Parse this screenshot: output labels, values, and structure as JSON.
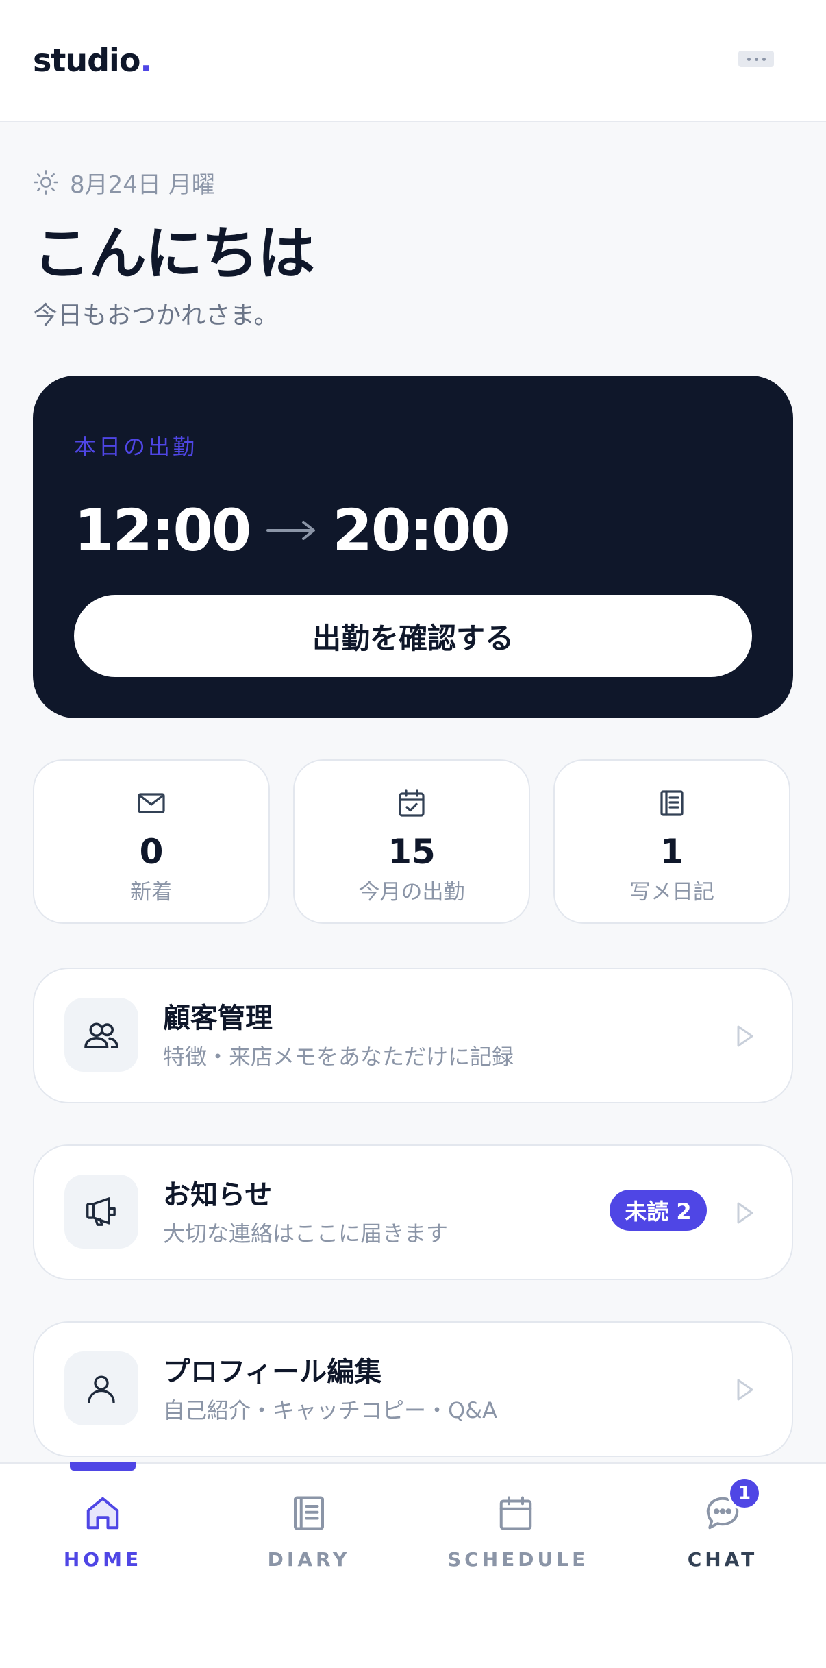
{
  "header": {
    "logo_text": "studio",
    "logo_dot": ".",
    "menu_icon": "more-dots-icon"
  },
  "greeting": {
    "date": "8月24日 月曜",
    "date_icon": "sun-icon",
    "title": "こんにちは",
    "subtitle": "今日もおつかれさま。"
  },
  "shift": {
    "label": "本日の出勤",
    "start": "12:00",
    "arrow": "→",
    "end": "20:00",
    "button_label": "出勤を確認する"
  },
  "stats": [
    {
      "icon": "mail-icon",
      "value": "0",
      "label": "新着"
    },
    {
      "icon": "calendar-check-icon",
      "value": "15",
      "label": "今月の出勤"
    },
    {
      "icon": "notebook-icon",
      "value": "1",
      "label": "写メ日記"
    }
  ],
  "menu": [
    {
      "icon": "users-icon",
      "title": "顧客管理",
      "desc": "特徴・来店メモをあなただけに記録",
      "badge": ""
    },
    {
      "icon": "megaphone-icon",
      "title": "お知らせ",
      "desc": "大切な連絡はここに届きます",
      "badge": "未読 2"
    },
    {
      "icon": "user-icon",
      "title": "プロフィール編集",
      "desc": "自己紹介・キャッチコピー・Q&A",
      "badge": ""
    }
  ],
  "nav": {
    "items": [
      {
        "label": "HOME",
        "icon": "home-icon",
        "active": true
      },
      {
        "label": "DIARY",
        "icon": "diary-icon",
        "active": false
      },
      {
        "label": "SCHEDULE",
        "icon": "calendar-icon",
        "active": false
      },
      {
        "label": "CHAT",
        "icon": "chat-icon",
        "active": false
      }
    ],
    "chat_badge": "1"
  },
  "colors": {
    "accent": "#4f46e5",
    "dark": "#0f172a",
    "muted": "#8b95a7",
    "background": "#f7f8fa"
  }
}
